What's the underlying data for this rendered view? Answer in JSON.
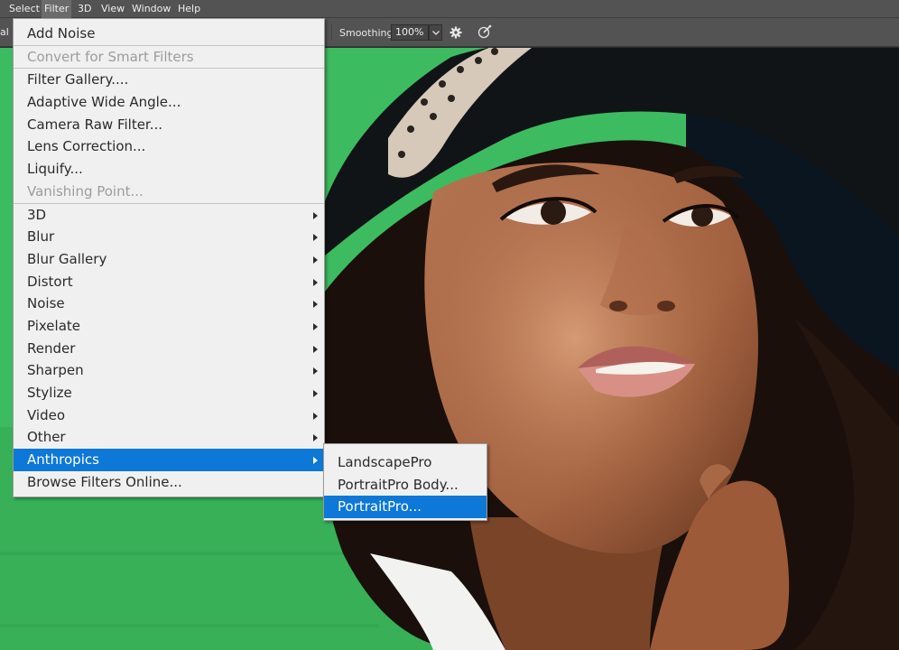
{
  "menubar": {
    "items": [
      {
        "label": "Select",
        "active": false
      },
      {
        "label": "Filter",
        "active": true
      },
      {
        "label": "3D",
        "active": false
      },
      {
        "label": "View",
        "active": false
      },
      {
        "label": "Window",
        "active": false
      },
      {
        "label": "Help",
        "active": false
      }
    ]
  },
  "options": {
    "left_fragment": "al",
    "smoothing_label": "Smoothing:",
    "smoothing_value": "100%"
  },
  "filter_menu": {
    "last_filter": "Add Noise",
    "convert_smart": "Convert for Smart Filters",
    "filter_gallery": "Filter Gallery....",
    "adaptive_wide_angle": "Adaptive Wide Angle...",
    "camera_raw": "Camera Raw Filter...",
    "lens_correction": "Lens Correction...",
    "liquify": "Liquify...",
    "vanishing_point": "Vanishing Point...",
    "submenus": [
      "3D",
      "Blur",
      "Blur Gallery",
      "Distort",
      "Noise",
      "Pixelate",
      "Render",
      "Sharpen",
      "Stylize",
      "Video",
      "Other",
      "Anthropics"
    ],
    "browse_online": "Browse Filters Online..."
  },
  "anthropics_menu": {
    "items": [
      "LandscapePro",
      "PortraitPro Body...",
      "PortraitPro..."
    ]
  },
  "colors": {
    "accent": "#0d78d8",
    "menu_bg": "#f0f0f0",
    "chrome": "#535353",
    "canvas_green": "#3fbd63"
  }
}
